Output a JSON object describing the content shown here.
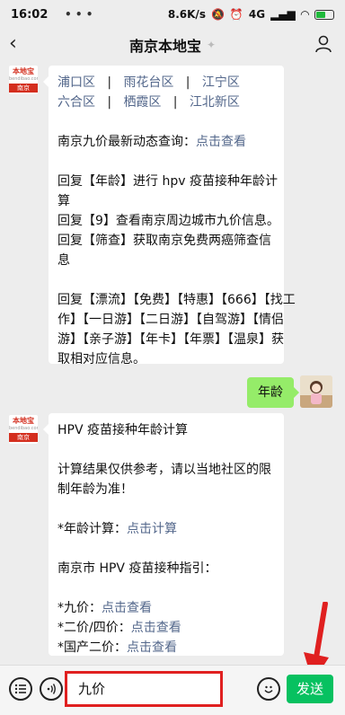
{
  "status": {
    "time": "16:02",
    "sys_icons": "• • •",
    "network": "8.6K/s",
    "signal": "4G",
    "battery_percent": 60,
    "battery_color": "#1fb93b"
  },
  "header": {
    "title": "南京本地宝",
    "verify_icon": "verified-icon"
  },
  "logo": {
    "brand": "本地宝",
    "domain": "bendibao.com",
    "city": "南京"
  },
  "message1": {
    "districts_row1": [
      "浦口区",
      "雨花台区",
      "江宁区"
    ],
    "districts_row2": [
      "六合区",
      "栖霞区",
      "江北新区"
    ],
    "sep": "|",
    "query_prefix": "南京九价最新动态查询：",
    "query_link": "点击查看",
    "reply_lines": [
      "回复【年龄】进行 hpv 疫苗接种年龄计",
      "算",
      "回复【9】查看南京周边城市九价信息。",
      "回复【筛查】获取南京免费两癌筛查信",
      "息"
    ],
    "keywords_lines": [
      "回复【漂流】【免费】【特惠】【666】【找工",
      "作】【一日游】【二日游】【自驾游】【情侣",
      "游】【亲子游】【年卡】【年票】【温泉】获",
      "取相对应信息。"
    ]
  },
  "user_message": {
    "text": "年龄",
    "bubble_color": "#95ec69"
  },
  "message2": {
    "title": "HPV 疫苗接种年龄计算",
    "note_lines": [
      "计算结果仅供参考，请以当地社区的限",
      "制年龄为准！"
    ],
    "calc_prefix": "*年龄计算：",
    "calc_link": "点击计算",
    "guide_title": "南京市 HPV 疫苗接种指引：",
    "items": [
      {
        "prefix": "*九价：",
        "link": "点击查看"
      },
      {
        "prefix": "*二价/四价：",
        "link": "点击查看"
      },
      {
        "prefix": "*国产二价：",
        "link": "点击查看"
      }
    ]
  },
  "input_bar": {
    "value": "九价",
    "send_label": "发送",
    "send_color": "#07c160",
    "highlight_color": "#e02020"
  }
}
